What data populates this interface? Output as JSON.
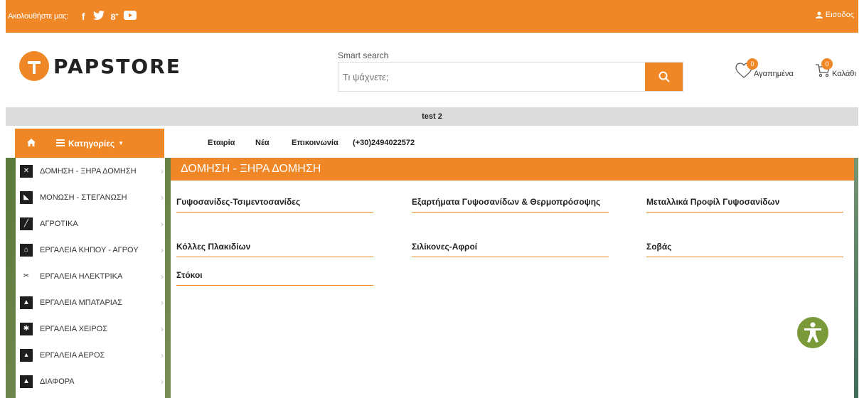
{
  "topbar": {
    "follow": "Ακολουθήστε μας:",
    "social": [
      "f",
      "t",
      "8+",
      "yt"
    ],
    "login": "Εισοδος"
  },
  "header": {
    "logo_text": "PAPSTORE",
    "search_label": "Smart search",
    "search_placeholder": "Τι ψάχνετε;",
    "wishlist_label": "Αγαπημένα",
    "wishlist_count": "0",
    "cart_label": "Καλάθι",
    "cart_count": "0"
  },
  "promo": {
    "text": "test 2"
  },
  "nav": {
    "categories": "Κατηγορίες",
    "links": [
      "Εταιρία",
      "Νέα",
      "Επικοινωνία",
      "(+30)2494022572"
    ]
  },
  "sidebar": {
    "items": [
      "ΔΟΜΗΣΗ - ΞΗΡΑ ΔΟΜΗΣΗ",
      "ΜΟΝΩΣΗ - ΣΤΕΓΑΝΩΣΗ",
      "ΑΓΡΟΤΙΚΑ",
      "ΕΡΓΑΛΕΙΑ ΚΗΠΟΥ - ΑΓΡΟΥ",
      "ΕΡΓΑΛΕΙΑ ΗΛΕΚΤΡΙΚΑ",
      "ΕΡΓΑΛΕΙΑ ΜΠΑΤΑΡΙΑΣ",
      "ΕΡΓΑΛΕΙΑ ΧΕΙΡΟΣ",
      "ΕΡΓΑΛΕΙΑ ΑΕΡΟΣ",
      "ΔΙΑΦΟΡΑ"
    ]
  },
  "panel": {
    "title": "ΔΟΜΗΣΗ - ΞΗΡΑ ΔΟΜΗΣΗ",
    "subcategories": [
      "Γυψοσανίδες-Τσιμεντοσανίδες",
      "Εξαρτήματα Γυψοσανίδων & Θερμοπρόσοψης",
      "Μεταλλικά Προφίλ Γυψοσανίδων",
      "Κόλλες Πλακιδίων",
      "Σιλίκονες-Αφροί",
      "Σοβάς",
      "Στόκοι"
    ]
  },
  "colors": {
    "accent": "#f08727",
    "promo_bg": "#dcdcdc"
  }
}
